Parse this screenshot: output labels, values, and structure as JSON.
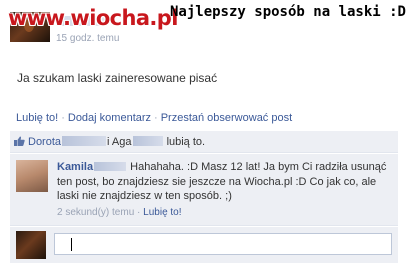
{
  "watermark": {
    "text": "www.wiocha.pl"
  },
  "caption": {
    "text": "Najlepszy sposób na laski :D"
  },
  "post": {
    "time": "15 godz. temu",
    "text": "Ja szukam laski zaineresowane pisać",
    "actions": [
      "Lubię to!",
      "Dodaj komentarz",
      "Przestań obserwować post"
    ]
  },
  "likes": {
    "name1": "Dorota",
    "joiner": "i Aga",
    "suffix": "lubią to."
  },
  "comment": {
    "author": "Kamila",
    "text": "Hahahaha. :D Masz 12 lat! Ja bym Ci radziła usunąć ten post, bo znajdziesz sie jeszcze na Wiocha.pl :D Co jak co, ale laski nie znajdziesz w ten sposób. ;)",
    "time": "2 sekund(y) temu",
    "like": "Lubię to!"
  },
  "reply": {
    "value": ""
  },
  "colors": {
    "link": "#3b5998",
    "panel": "#edeff4",
    "watermark": "#c8171d"
  }
}
